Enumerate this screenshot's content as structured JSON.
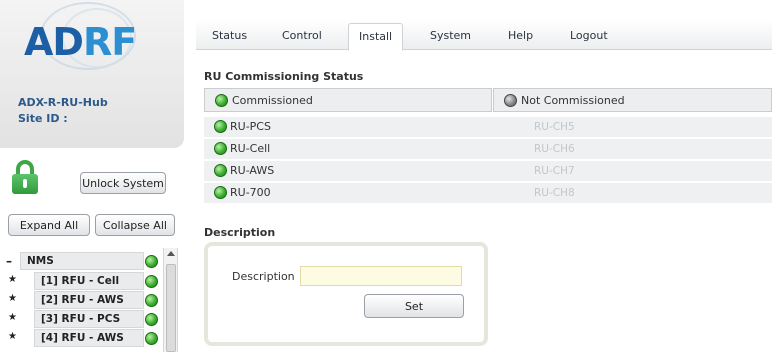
{
  "sidebar": {
    "logo_text": "ADRF",
    "device_name": "ADX-R-RU-Hub",
    "site_id_label": "Site ID :",
    "lock_icon": "padlock-open-icon",
    "unlock_label": "Unlock System",
    "expand_label": "Expand All",
    "collapse_label": "Collapse All",
    "tree": {
      "root": {
        "label": "NMS",
        "status": "green"
      },
      "items": [
        {
          "label": "[1] RFU - Cell",
          "status": "green"
        },
        {
          "label": "[2] RFU - AWS",
          "status": "green"
        },
        {
          "label": "[3] RFU - PCS",
          "status": "green"
        },
        {
          "label": "[4] RFU - AWS",
          "status": "green"
        }
      ]
    }
  },
  "nav": {
    "tabs": [
      {
        "label": "Status"
      },
      {
        "label": "Control"
      },
      {
        "label": "Install",
        "active": true
      },
      {
        "label": "System"
      },
      {
        "label": "Help"
      },
      {
        "label": "Logout"
      }
    ]
  },
  "commissioning": {
    "title": "RU Commissioning Status",
    "legend": {
      "commissioned": "Commissioned",
      "not_commissioned": "Not Commissioned"
    },
    "rows": [
      {
        "left": "RU-PCS",
        "right": "RU-CH5"
      },
      {
        "left": "RU-Cell",
        "right": "RU-CH6"
      },
      {
        "left": "RU-AWS",
        "right": "RU-CH7"
      },
      {
        "left": "RU-700",
        "right": "RU-CH8"
      }
    ]
  },
  "description": {
    "title": "Description",
    "field_label": "Description",
    "field_value": "",
    "set_label": "Set"
  },
  "colors": {
    "status_green": "#3db02f",
    "status_grey": "#8a8a8a",
    "brand_blue": "#1c5fa6"
  }
}
